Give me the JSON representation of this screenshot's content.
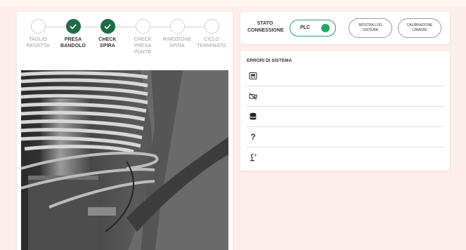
{
  "stepper": {
    "steps": [
      {
        "label": "TAGLIO\nREGETTA",
        "done": false
      },
      {
        "label": "PRESA\nBANDOLO",
        "done": true
      },
      {
        "label": "CHECK\nSPIRA",
        "done": true
      },
      {
        "label": "CHECK\nPRESA\nPUNTE",
        "done": false
      },
      {
        "label": "RIMOZIONE\nSPIRA",
        "done": false
      },
      {
        "label": "CICLO\nTERMINATO",
        "done": false
      }
    ]
  },
  "status": {
    "label": "STATO\nCONNESSIONE",
    "plc_label": "PLC",
    "plc_connected": true,
    "plc_color": "#1fa85c",
    "log_button": "MOSTRA LOG\nSISTEMA",
    "camera_button": "CALIBRAZIONE\nCAMERE"
  },
  "errors": {
    "title": "ERRORI DI SISTEMA",
    "items": [
      {
        "icon": "device-icon",
        "text": ""
      },
      {
        "icon": "camera-off-icon",
        "text": ""
      },
      {
        "icon": "database-icon",
        "text": ""
      },
      {
        "icon": "question-icon",
        "text": "?"
      },
      {
        "icon": "robot-arm-icon",
        "text": ""
      }
    ]
  },
  "colors": {
    "accent": "#1e6b45",
    "background": "#fcefeb"
  }
}
